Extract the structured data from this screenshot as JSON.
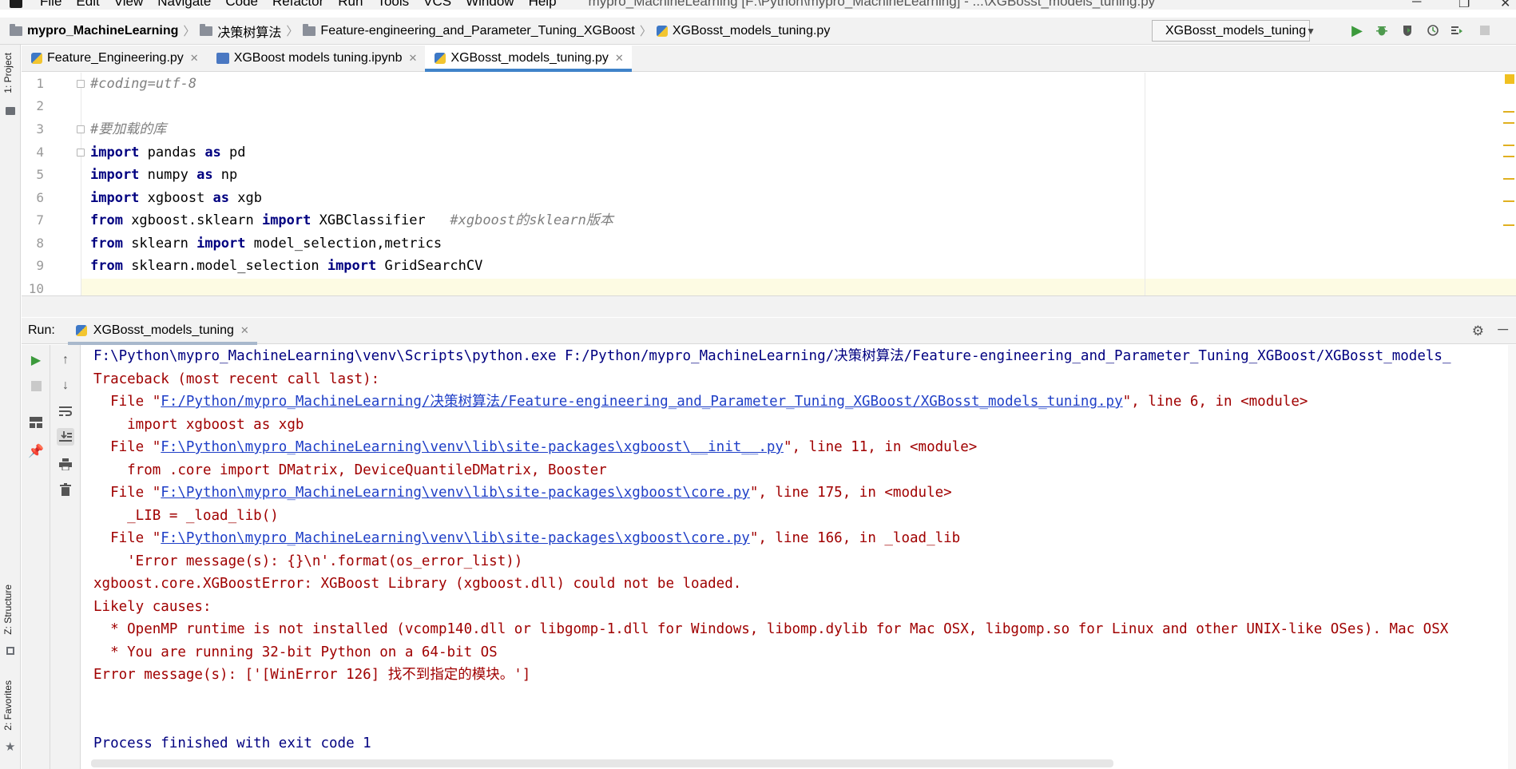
{
  "menu": {
    "items": [
      "File",
      "Edit",
      "View",
      "Navigate",
      "Code",
      "Refactor",
      "Run",
      "Tools",
      "VCS",
      "Window",
      "Help"
    ],
    "window_title": "mypro_MachineLearning [F:\\Python\\mypro_MachineLearning] - ...\\XGBosst_models_tuning.py"
  },
  "breadcrumb": {
    "project": "mypro_MachineLearning",
    "folder1": "决策树算法",
    "folder2": "Feature-engineering_and_Parameter_Tuning_XGBoost",
    "file": "XGBosst_models_tuning.py"
  },
  "run_config": {
    "selected": "XGBosst_models_tuning"
  },
  "left_strip": {
    "project_tab": "1: Project",
    "structure_tab": "Z: Structure",
    "favorites_tab": "2: Favorites"
  },
  "tabs": [
    {
      "label": "Feature_Engineering.py",
      "active": false
    },
    {
      "label": "XGBoost models tuning.ipynb",
      "active": false
    },
    {
      "label": "XGBosst_models_tuning.py",
      "active": true
    }
  ],
  "editor": {
    "line_numbers": [
      "1",
      "2",
      "3",
      "4",
      "5",
      "6",
      "7",
      "8",
      "9",
      "10"
    ],
    "lines": {
      "l1_comment": "#coding=utf-8",
      "l3_comment": "#要加载的库",
      "l4": {
        "k1": "import",
        "m": " pandas ",
        "k2": "as",
        "a": " pd"
      },
      "l5": {
        "k1": "import",
        "m": " numpy ",
        "k2": "as",
        "a": " np"
      },
      "l6": {
        "k1": "import",
        "m": " xgboost ",
        "k2": "as",
        "a": " xgb"
      },
      "l7": {
        "k1": "from",
        "m": " xgboost.sklearn ",
        "k2": "import",
        "a": " XGBClassifier   ",
        "c": "#xgboost的sklearn版本"
      },
      "l8": {
        "k1": "from",
        "m": " sklearn ",
        "k2": "import",
        "a": " model_selection,metrics"
      },
      "l9": {
        "k1": "from",
        "m": " sklearn.model_selection ",
        "k2": "import",
        "a": " GridSearchCV"
      }
    }
  },
  "run": {
    "label": "Run:",
    "tab_label": "XGBosst_models_tuning",
    "console": {
      "cmd": "F:\\Python\\mypro_MachineLearning\\venv\\Scripts\\python.exe F:/Python/mypro_MachineLearning/决策树算法/Feature-engineering_and_Parameter_Tuning_XGBoost/XGBosst_models_",
      "traceback": "Traceback (most recent call last):",
      "f1_pre": "  File \"",
      "f1_link": "F:/Python/mypro_MachineLearning/决策树算法/Feature-engineering_and_Parameter_Tuning_XGBoost/XGBosst_models_tuning.py",
      "f1_post": "\", line 6, in <module>",
      "f1_code": "    import xgboost as xgb",
      "f2_pre": "  File \"",
      "f2_link": "F:\\Python\\mypro_MachineLearning\\venv\\lib\\site-packages\\xgboost\\__init__.py",
      "f2_post": "\", line 11, in <module>",
      "f2_code": "    from .core import DMatrix, DeviceQuantileDMatrix, Booster",
      "f3_pre": "  File \"",
      "f3_link": "F:\\Python\\mypro_MachineLearning\\venv\\lib\\site-packages\\xgboost\\core.py",
      "f3_post": "\", line 175, in <module>",
      "f3_code": "    _LIB = _load_lib()",
      "f4_pre": "  File \"",
      "f4_link": "F:\\Python\\mypro_MachineLearning\\venv\\lib\\site-packages\\xgboost\\core.py",
      "f4_post": "\", line 166, in _load_lib",
      "f4_code": "    'Error message(s): {}\\n'.format(os_error_list))",
      "error": "xgboost.core.XGBoostError: XGBoost Library (xgboost.dll) could not be loaded.",
      "likely": "Likely causes:",
      "cause1": "  * OpenMP runtime is not installed (vcomp140.dll or libgomp-1.dll for Windows, libomp.dylib for Mac OSX, libgomp.so for Linux and other UNIX-like OSes). Mac OSX",
      "cause2": "  * You are running 32-bit Python on a 64-bit OS",
      "errmsg": "Error message(s): ['[WinError 126] 找不到指定的模块。']",
      "finished": "Process finished with exit code 1"
    }
  },
  "colors": {
    "keyword": "#000080",
    "comment": "#808080",
    "error_text": "#a00000",
    "link": "#1f3fc7",
    "active_tab_underline": "#4083c9",
    "run_green": "#3c9a3c"
  }
}
